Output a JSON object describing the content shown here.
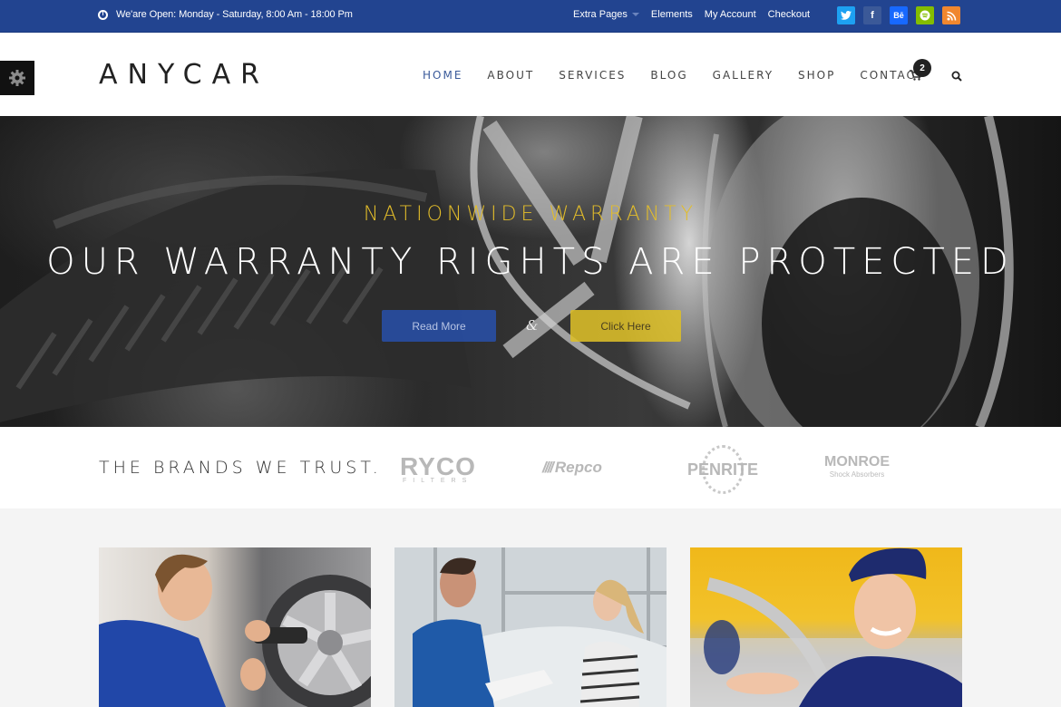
{
  "topbar": {
    "hours_text": "We'are Open: Monday - Saturday, 8:00 Am - 18:00 Pm",
    "links": [
      {
        "label": "Extra Pages",
        "has_dropdown": true
      },
      {
        "label": "Elements"
      },
      {
        "label": "My Account"
      },
      {
        "label": "Checkout"
      }
    ],
    "socials": [
      {
        "name": "twitter",
        "glyph": "🐦",
        "color": "#1da1f2"
      },
      {
        "name": "facebook",
        "glyph": "f",
        "color": "#3b5998"
      },
      {
        "name": "behance",
        "glyph": "Bē",
        "color": "#1769ff"
      },
      {
        "name": "spotify",
        "glyph": "≋",
        "color": "#84bd00"
      },
      {
        "name": "rss",
        "glyph": "⟟",
        "color": "#f0872f"
      }
    ]
  },
  "header": {
    "logo": "ANYCAR",
    "nav": [
      {
        "label": "HOME",
        "active": true
      },
      {
        "label": "ABOUT"
      },
      {
        "label": "SERVICES"
      },
      {
        "label": "BLOG"
      },
      {
        "label": "GALLERY"
      },
      {
        "label": "SHOP"
      },
      {
        "label": "CONTACT"
      }
    ],
    "cart_count": "2"
  },
  "hero": {
    "kicker": "NATIONWIDE WARRANTY",
    "headline": "OUR WARRANTY RIGHTS ARE PROTECTED",
    "primary_button": "Read More",
    "separator": "&",
    "secondary_button": "Click Here",
    "colors": {
      "kicker": "#e3bd2a",
      "primary": "#2850aa",
      "secondary": "#dcbe28"
    }
  },
  "brands": {
    "title": "THE BRANDS WE TRUST.",
    "logos": [
      {
        "name": "RYCO",
        "sub": "FILTERS"
      },
      {
        "name": "Repco"
      },
      {
        "name": "PENRITE"
      },
      {
        "name": "MONROE",
        "sub": "Shock Absorbers"
      }
    ]
  },
  "cards": [
    {
      "alt": "Mechanic using impact wrench on car wheel"
    },
    {
      "alt": "Mechanic showing clipboard to customer"
    },
    {
      "alt": "Smiling service attendant in cap"
    }
  ],
  "colors": {
    "topbar_bg": "#224490",
    "accent_blue": "#3a5a9a",
    "dark": "#222222"
  }
}
